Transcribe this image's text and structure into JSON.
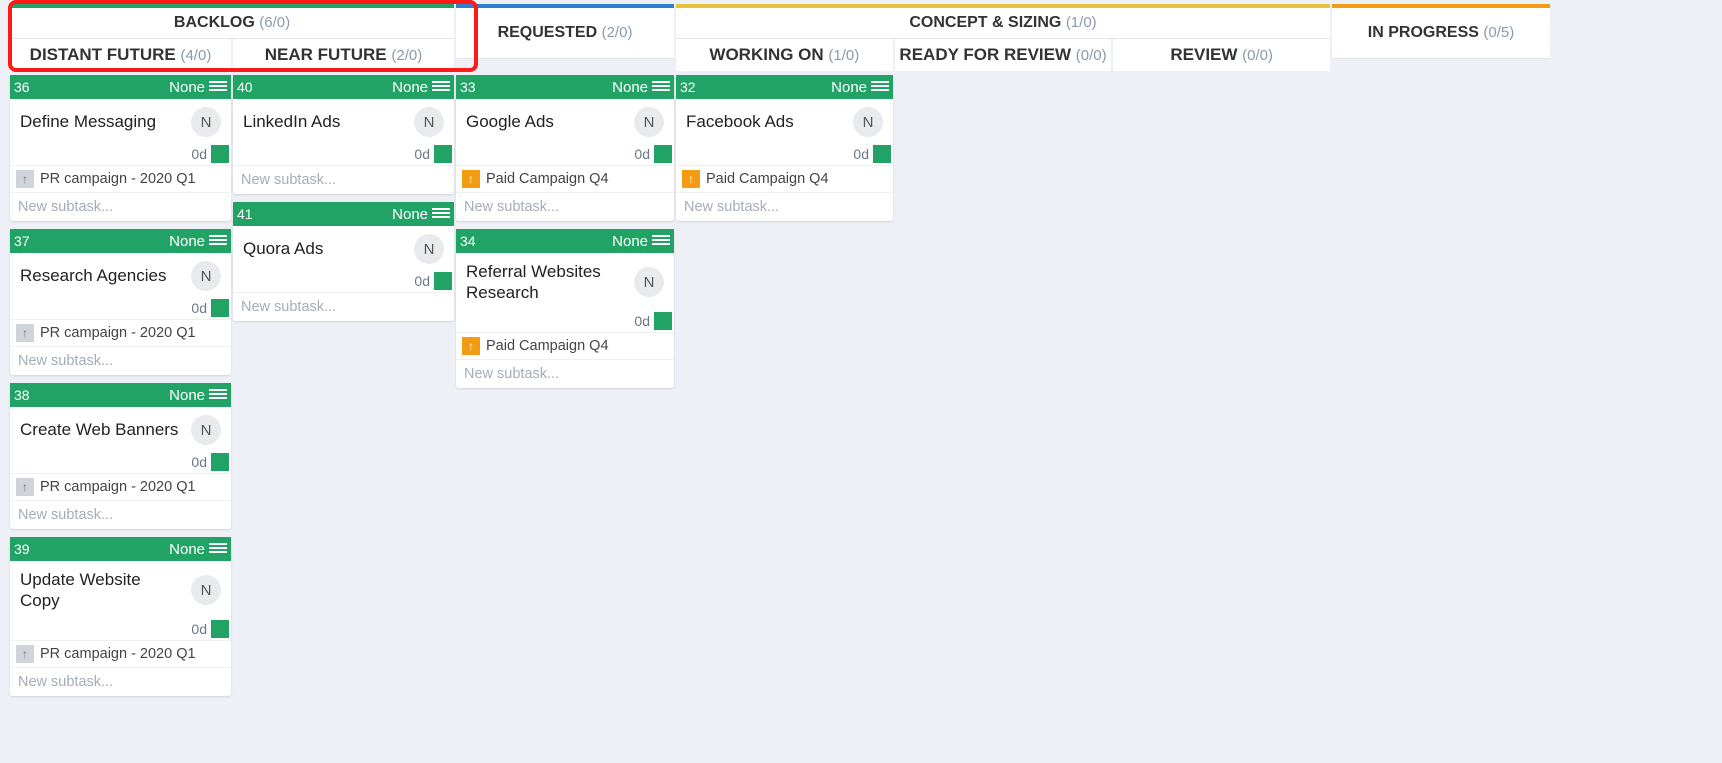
{
  "placeholders": {
    "new_subtask": "New subtask..."
  },
  "parents": {
    "pr": "PR campaign - 2020 Q1",
    "paid": "Paid Campaign Q4"
  },
  "avatar_initial": "N",
  "common": {
    "none": "None",
    "dur": "0d"
  },
  "cols": {
    "backlog": {
      "title": "BACKLOG",
      "count": "(6/0)",
      "subs": {
        "distant": {
          "title": "DISTANT FUTURE",
          "count": "(4/0)"
        },
        "near": {
          "title": "NEAR FUTURE",
          "count": "(2/0)"
        }
      }
    },
    "requested": {
      "title": "REQUESTED",
      "count": "(2/0)"
    },
    "concept": {
      "title": "CONCEPT & SIZING",
      "count": "(1/0)",
      "subs": {
        "working": {
          "title": "WORKING ON",
          "count": "(1/0)"
        },
        "ready": {
          "title": "READY FOR REVIEW",
          "count": "(0/0)"
        },
        "review": {
          "title": "REVIEW",
          "count": "(0/0)"
        }
      }
    },
    "progress": {
      "title": "IN PROGRESS",
      "count": "(0/5)"
    }
  },
  "lanes": {
    "distant": [
      {
        "id": "36",
        "title": "Define Messaging",
        "parent": "pr",
        "arrow": "grey"
      },
      {
        "id": "37",
        "title": "Research Agencies",
        "parent": "pr",
        "arrow": "grey"
      },
      {
        "id": "38",
        "title": "Create Web Banners",
        "parent": "pr",
        "arrow": "grey"
      },
      {
        "id": "39",
        "title": "Update Website Copy",
        "parent": "pr",
        "arrow": "grey"
      }
    ],
    "near": [
      {
        "id": "40",
        "title": "LinkedIn Ads"
      },
      {
        "id": "41",
        "title": "Quora Ads"
      }
    ],
    "requested": [
      {
        "id": "33",
        "title": "Google Ads",
        "parent": "paid",
        "arrow": "orange"
      },
      {
        "id": "34",
        "title": "Referral Websites Research",
        "parent": "paid",
        "arrow": "orange"
      }
    ],
    "working": [
      {
        "id": "32",
        "title": "Facebook Ads",
        "parent": "paid",
        "arrow": "orange"
      }
    ]
  }
}
